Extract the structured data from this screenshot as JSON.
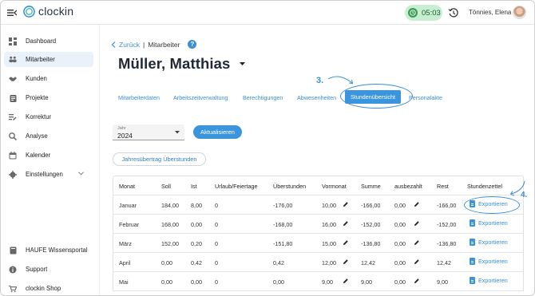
{
  "app": {
    "logo_text": "clockin",
    "timer": "05:03",
    "user_name": "Tönnies, Elena"
  },
  "sidebar": {
    "items": [
      {
        "label": "Dashboard",
        "icon": "dashboard-icon"
      },
      {
        "label": "Mitarbeiter",
        "icon": "people-icon",
        "active": true
      },
      {
        "label": "Kunden",
        "icon": "handshake-icon"
      },
      {
        "label": "Projekte",
        "icon": "clipboard-icon"
      },
      {
        "label": "Korrektur",
        "icon": "edit-list-icon"
      },
      {
        "label": "Analyse",
        "icon": "analyze-icon"
      },
      {
        "label": "Kalender",
        "icon": "calendar-icon"
      },
      {
        "label": "Einstellungen",
        "icon": "gear-icon"
      }
    ],
    "bottom_items": [
      {
        "label": "HAUFE Wissensportal",
        "icon": "book-icon"
      },
      {
        "label": "Support",
        "icon": "info-icon"
      },
      {
        "label": "clockin Shop",
        "icon": "cart-icon"
      }
    ]
  },
  "breadcrumb": {
    "back": "Zurück",
    "separator": "|",
    "current": "Mitarbeiter",
    "help": "?"
  },
  "employee_name": "Müller, Matthias",
  "tabs": [
    {
      "label": "Mitarbeiterdaten"
    },
    {
      "label": "Arbeitszeitverwaltung"
    },
    {
      "label": "Berechtigungen"
    },
    {
      "label": "Abwesenheiten"
    },
    {
      "label": "Stundenübersicht",
      "active": true
    },
    {
      "label": "Personalakte"
    }
  ],
  "annotations": {
    "step3": "3.",
    "step4": "4."
  },
  "year_select": {
    "label": "Jahr",
    "value": "2024"
  },
  "buttons": {
    "refresh": "Aktualisieren",
    "carryover": "Jahresübertrag Überstunden"
  },
  "table": {
    "headers": [
      "Monat",
      "Soll",
      "Ist",
      "Urlaub/Feiertage",
      "Überstunden",
      "Vormonat",
      "Summe",
      "ausbezahlt",
      "Rest",
      "Stundenzettel"
    ],
    "rows": [
      {
        "monat": "Januar",
        "soll": "184,00",
        "ist": "8,00",
        "urlaub": "0",
        "ueberstunden": "-176,00",
        "vormonat": "10,00",
        "summe": "-166,00",
        "ausbezahlt": "0,00",
        "rest": "-166,00",
        "export": "Exportieren"
      },
      {
        "monat": "Februar",
        "soll": "168,00",
        "ist": "0,00",
        "urlaub": "0",
        "ueberstunden": "-168,00",
        "vormonat": "16,00",
        "summe": "-152,00",
        "ausbezahlt": "0,00",
        "rest": "-152,00",
        "export": "Exportieren"
      },
      {
        "monat": "März",
        "soll": "152,00",
        "ist": "0,20",
        "urlaub": "0",
        "ueberstunden": "-151,80",
        "vormonat": "15,00",
        "summe": "-136,80",
        "ausbezahlt": "0,00",
        "rest": "-136,80",
        "export": "Exportieren"
      },
      {
        "monat": "April",
        "soll": "0,00",
        "ist": "0,42",
        "urlaub": "0",
        "ueberstunden": "0,42",
        "vormonat": "12,00",
        "summe": "12,42",
        "ausbezahlt": "0,00",
        "rest": "12,42",
        "export": "Exportieren"
      },
      {
        "monat": "Mai",
        "soll": "0,00",
        "ist": "0,00",
        "urlaub": "0",
        "ueberstunden": "0,00",
        "vormonat": "9,00",
        "summe": "9,00",
        "ausbezahlt": "0,00",
        "rest": "9,00",
        "export": "Exportieren"
      }
    ]
  },
  "colors": {
    "accent": "#3a95dc",
    "timer_bg": "#c8eed2",
    "active_nav": "#e9f1fb"
  }
}
